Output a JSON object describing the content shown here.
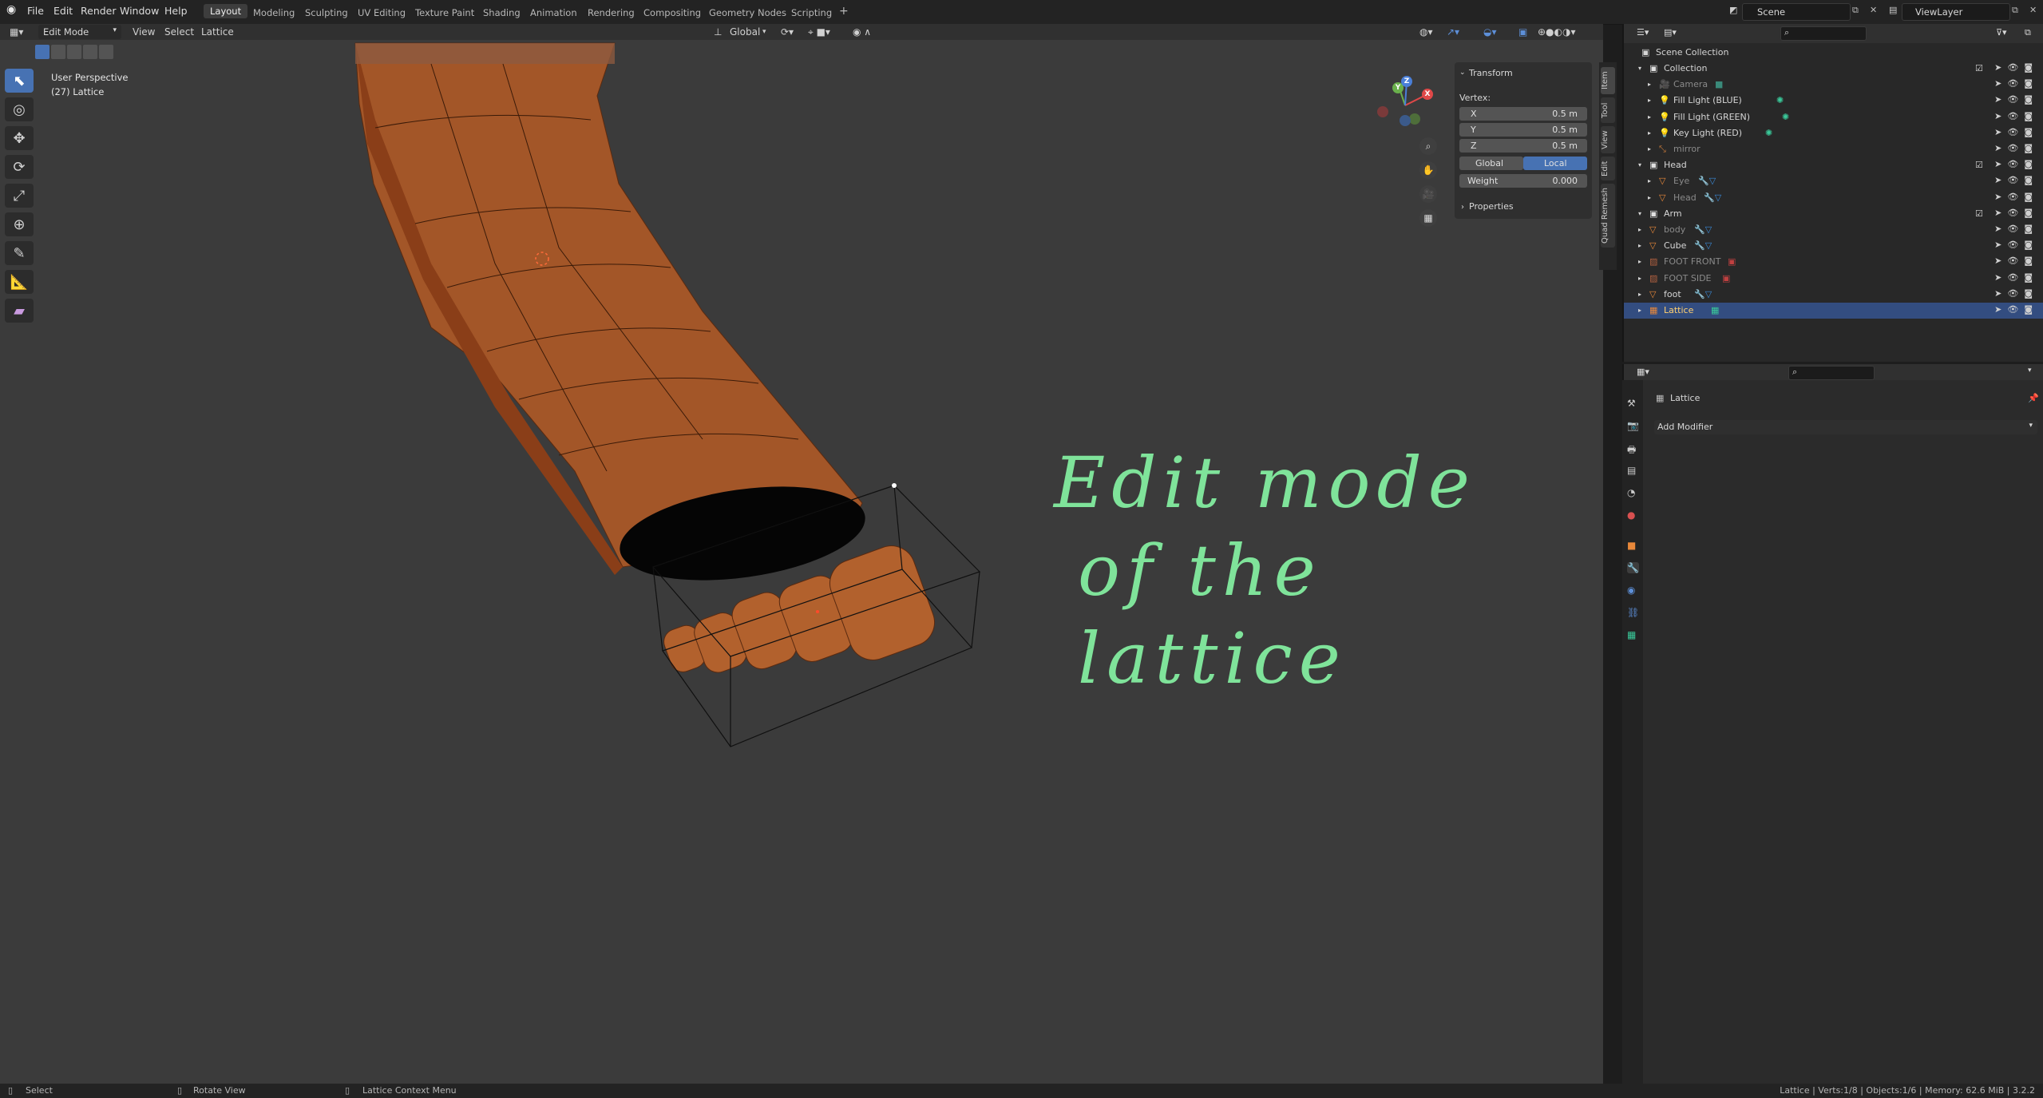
{
  "topbar": {
    "menus": [
      "File",
      "Edit",
      "Render",
      "Window",
      "Help"
    ],
    "workspaces": [
      "Layout",
      "Modeling",
      "Sculpting",
      "UV Editing",
      "Texture Paint",
      "Shading",
      "Animation",
      "Rendering",
      "Compositing",
      "Geometry Nodes",
      "Scripting"
    ],
    "add_tab": "+",
    "scene": "Scene",
    "view_layer": "ViewLayer"
  },
  "viewport_header": {
    "mode": "Edit Mode",
    "menus": [
      "View",
      "Select",
      "Lattice"
    ],
    "orientation": "Global"
  },
  "viewport": {
    "perspective": "User Perspective",
    "object_info": "(27) Lattice",
    "annotation_line1": "Edit mode",
    "annotation_line2": "of the lattice",
    "gizmo_axes": {
      "x": "X",
      "y": "Y",
      "z": "Z"
    }
  },
  "npanel": {
    "section": "Transform",
    "vertex_label": "Vertex:",
    "x_label": "X",
    "x_value": "0.5 m",
    "y_label": "Y",
    "y_value": "0.5 m",
    "z_label": "Z",
    "z_value": "0.5 m",
    "global_label": "Global",
    "local_label": "Local",
    "weight_label": "Weight",
    "weight_value": "0.000",
    "properties_label": "Properties",
    "tabs": [
      "Item",
      "Tool",
      "View",
      "Edit",
      "Quad Remesh"
    ]
  },
  "outliner": {
    "root": "Scene Collection",
    "rows": [
      {
        "name": "Collection",
        "indent": 1,
        "kind": "collection"
      },
      {
        "name": "Camera",
        "indent": 2,
        "kind": "camera",
        "dim": true
      },
      {
        "name": "Fill Light (BLUE)",
        "indent": 2,
        "kind": "light"
      },
      {
        "name": "Fill Light (GREEN)",
        "indent": 2,
        "kind": "light"
      },
      {
        "name": "Key Light (RED)",
        "indent": 2,
        "kind": "light"
      },
      {
        "name": "mirror",
        "indent": 2,
        "kind": "empty",
        "dim": true
      },
      {
        "name": "Head",
        "indent": 1,
        "kind": "collection"
      },
      {
        "name": "Eye",
        "indent": 2,
        "kind": "mesh",
        "dim": true
      },
      {
        "name": "Head",
        "indent": 2,
        "kind": "mesh",
        "dim": true
      },
      {
        "name": "Arm",
        "indent": 1,
        "kind": "collection"
      },
      {
        "name": "body",
        "indent": 1,
        "kind": "mesh",
        "dim": true
      },
      {
        "name": "Cube",
        "indent": 1,
        "kind": "mesh"
      },
      {
        "name": "FOOT FRONT",
        "indent": 1,
        "kind": "image",
        "dim": true
      },
      {
        "name": "FOOT SIDE",
        "indent": 1,
        "kind": "image",
        "dim": true
      },
      {
        "name": "foot",
        "indent": 1,
        "kind": "mesh"
      },
      {
        "name": "Lattice",
        "indent": 1,
        "kind": "lattice",
        "selected": true
      }
    ]
  },
  "properties": {
    "object_name": "Lattice",
    "add_modifier": "Add Modifier"
  },
  "statusbar": {
    "select": "Select",
    "rotate": "Rotate View",
    "context": "Lattice Context Menu",
    "stats": "Lattice | Verts:1/8 | Objects:1/6 | Memory: 62.6 MiB | 3.2.2"
  },
  "colors": {
    "accent": "#4772b3",
    "foot": "#a0552a",
    "annotation": "#7fe39a",
    "viewport_bg": "#3b3b3b"
  }
}
